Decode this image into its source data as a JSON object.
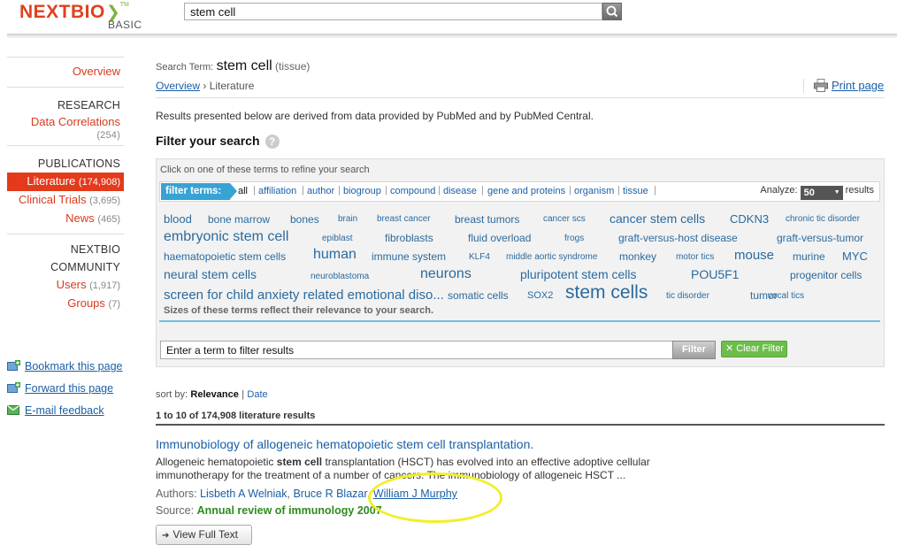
{
  "header": {
    "logo_main": "NEXTBIO",
    "logo_sub": "BASIC",
    "search_value": "stem cell"
  },
  "nav": {
    "overview": "Overview",
    "research_head": "RESEARCH",
    "data_correlations": "Data Correlations",
    "data_correlations_count": "(254)",
    "publications_head": "PUBLICATIONS",
    "literature": "Literature",
    "literature_count": "(174,908)",
    "clinical_trials": "Clinical Trials",
    "clinical_trials_count": "(3,695)",
    "news": "News",
    "news_count": "(465)",
    "community_head": "NEXTBIO COMMUNITY",
    "users": "Users",
    "users_count": "(1,917)",
    "groups": "Groups",
    "groups_count": "(7)",
    "bookmark": "Bookmark this page",
    "forward": "Forward this page",
    "email": "E-mail feedback"
  },
  "main": {
    "search_term_label": "Search Term:",
    "search_term": "stem cell",
    "search_term_type": "(tissue)",
    "crumb_overview": "Overview",
    "crumb_sep": "›",
    "crumb_current": "Literature",
    "print": "Print page",
    "source_note": "Results presented below are derived from data provided by PubMed and by PubMed Central.",
    "filter_title": "Filter your search",
    "filter_hint": "Click on one of these terms to refine your search",
    "filter_terms_label": "filter terms:",
    "categories": [
      "all",
      "affiliation",
      "author",
      "biogroup",
      "compound",
      "disease",
      "gene and proteins",
      "organism",
      "tissue"
    ],
    "analyze_label": "Analyze:",
    "analyze_value": "50",
    "analyze_suffix": "results",
    "cloud_note": "Sizes of these terms reflect their relevance to your search.",
    "filter_input": "Enter a term to filter results",
    "filter_button": "Filter",
    "clear_button": "Clear Filter",
    "sort_label": "sort by:",
    "sort_selected": "Relevance",
    "sort_sep": "|",
    "sort_other": "Date",
    "result_count": "1 to 10 of 174,908 literature results"
  },
  "cloud": [
    {
      "t": "blood",
      "s": 13
    },
    {
      "t": "bone marrow",
      "s": 12
    },
    {
      "t": "bones",
      "s": 12
    },
    {
      "t": "brain",
      "s": 10
    },
    {
      "t": "breast cancer",
      "s": 10
    },
    {
      "t": "breast tumors",
      "s": 12
    },
    {
      "t": "cancer scs",
      "s": 10
    },
    {
      "t": "cancer stem cells",
      "s": 14
    },
    {
      "t": "CDKN3",
      "s": 13
    },
    {
      "t": "chronic tic disorder",
      "s": 10
    },
    {
      "t": "embryonic stem cell",
      "s": 16
    },
    {
      "t": "epiblast",
      "s": 10
    },
    {
      "t": "fibroblasts",
      "s": 12
    },
    {
      "t": "fluid overload",
      "s": 12
    },
    {
      "t": "frogs",
      "s": 10
    },
    {
      "t": "graft-versus-host disease",
      "s": 12
    },
    {
      "t": "graft-versus-tumor",
      "s": 12
    },
    {
      "t": "haematopoietic stem cells",
      "s": 12
    },
    {
      "t": "human",
      "s": 16
    },
    {
      "t": "immune system",
      "s": 12
    },
    {
      "t": "KLF4",
      "s": 10
    },
    {
      "t": "middle aortic syndrome",
      "s": 10
    },
    {
      "t": "monkey",
      "s": 12
    },
    {
      "t": "motor tics",
      "s": 10
    },
    {
      "t": "mouse",
      "s": 15
    },
    {
      "t": "murine",
      "s": 12
    },
    {
      "t": "MYC",
      "s": 13
    },
    {
      "t": "neural stem cells",
      "s": 14
    },
    {
      "t": "neuroblastoma",
      "s": 10
    },
    {
      "t": "neurons",
      "s": 16
    },
    {
      "t": "pluripotent stem cells",
      "s": 14
    },
    {
      "t": "POU5F1",
      "s": 14
    },
    {
      "t": "progenitor cells",
      "s": 12
    },
    {
      "t": "screen for child anxiety related emotional diso...",
      "s": 15
    },
    {
      "t": "somatic cells",
      "s": 12
    },
    {
      "t": "SOX2",
      "s": 11
    },
    {
      "t": "stem cells",
      "s": 21
    },
    {
      "t": "tic disorder",
      "s": 10
    },
    {
      "t": "tumor",
      "s": 12
    },
    {
      "t": "vocal tics",
      "s": 10
    }
  ],
  "result": {
    "title": "Immunobiology of allogeneic hematopoietic stem cell transplantation.",
    "abstract_pre": "Allogeneic hematopoietic ",
    "abstract_bold": "stem cell",
    "abstract_post": " transplantation (HSCT) has evolved into an effective adoptive cellular immunotherapy for the treatment of a number of cancers. The immunobiology of allogeneic HSCT ...",
    "authors_label": "Authors:",
    "authors": [
      "Lisbeth A Welniak",
      "Bruce R Blazar",
      "William J Murphy"
    ],
    "source_label": "Source:",
    "source": "Annual review of immunology 2007",
    "full_text_button": "View Full Text"
  }
}
